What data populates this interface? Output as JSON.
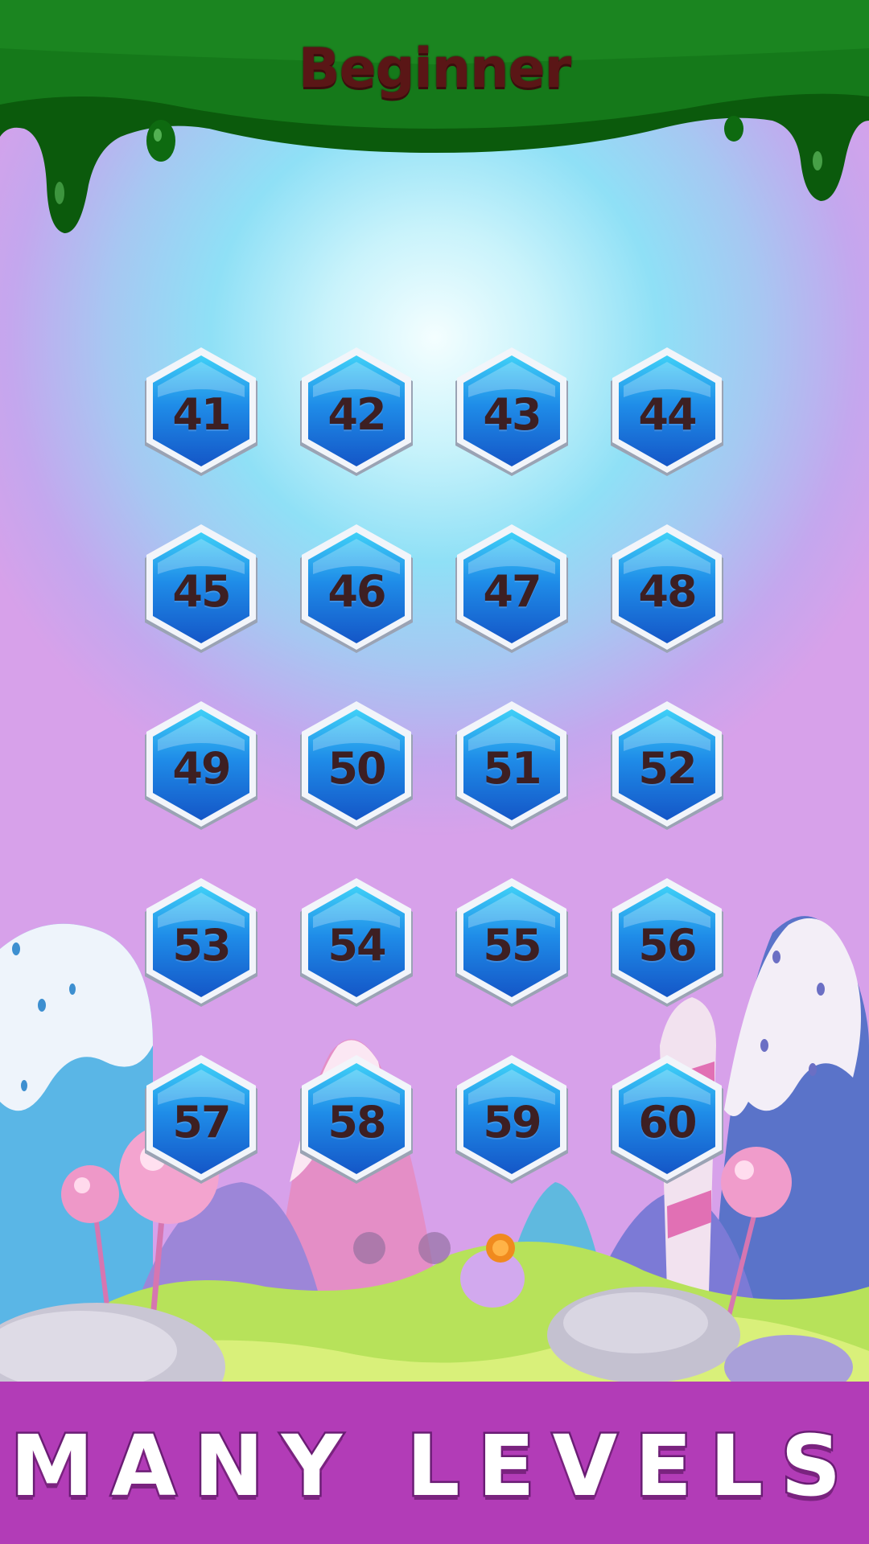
{
  "header": {
    "title": "Beginner"
  },
  "levels": [
    "41",
    "42",
    "43",
    "44",
    "45",
    "46",
    "47",
    "48",
    "49",
    "50",
    "51",
    "52",
    "53",
    "54",
    "55",
    "56",
    "57",
    "58",
    "59",
    "60"
  ],
  "pagination": {
    "pages": 2,
    "current": 1
  },
  "footer": {
    "banner_text": "MANY LEVELS"
  },
  "colors": {
    "slime": "#0f6a10",
    "tile_blue": "#1e7de8",
    "tile_rim": "#e9eef5",
    "number_text": "#3d1f22",
    "footer_bg": "#b23cb7"
  },
  "icons": {
    "page_indicator": "dot-icon",
    "level_tile": "hexagon-icon"
  }
}
